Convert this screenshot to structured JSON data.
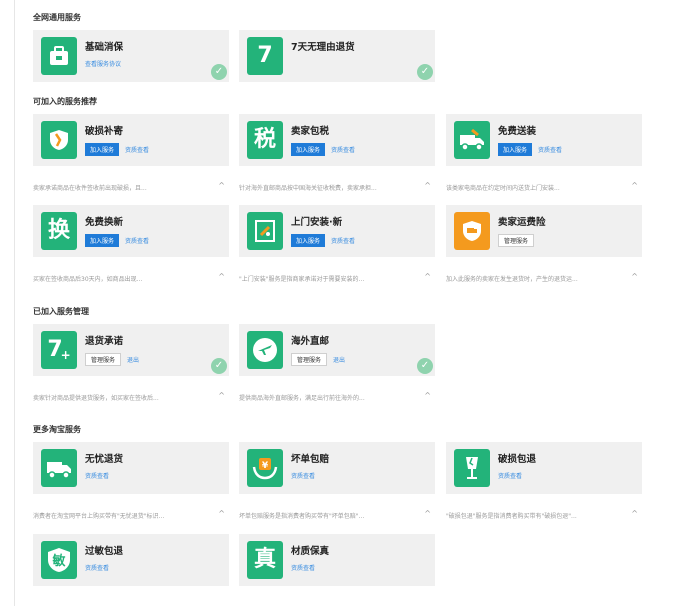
{
  "sections": {
    "network": "全网通用服务",
    "joinable": "可加入的服务推荐",
    "joined": "已加入服务管理",
    "more": "更多淘宝服务"
  },
  "buttons": {
    "join": "加入服务",
    "detail": "资质查看",
    "manage": "管理服务",
    "exit": "退出",
    "agreement": "查看服务协议"
  },
  "cards": {
    "basic": {
      "name": "基础消保",
      "glyph": ""
    },
    "seven_day": {
      "name": "7天无理由退货",
      "glyph": "7"
    },
    "damage": {
      "name": "破损补寄",
      "desc": "卖家承诺商品在收件签收前出现破损，且..."
    },
    "tax": {
      "name": "卖家包税",
      "glyph": "税",
      "desc": "针对海外直邮商品按中国海关征收税费，卖家承担..."
    },
    "install_free": {
      "name": "免费送装",
      "desc": "该类家电商品在约定时间内送货上门安装..."
    },
    "exchange": {
      "name": "免费换新",
      "glyph": "换",
      "desc": "买家在签收商品后30天内，如商品出现..."
    },
    "install": {
      "name": "上门安装·新",
      "desc": "\"上门安装\"服务是指商家承诺对于需要安装的..."
    },
    "freight": {
      "name": "卖家运费险",
      "desc": "加入此服务的卖家在发生退货时，产生的退货运..."
    },
    "return_promise": {
      "name": "退货承诺",
      "glyph": "7",
      "desc": "卖家针对商品提供退货服务，如买家在签收后..."
    },
    "overseas": {
      "name": "海外直邮",
      "desc": "提供商品海外直邮服务，满足出行前往海外的..."
    },
    "no_worry": {
      "name": "无忧退货",
      "desc": "消费者在淘宝网平台上购买带有\"无忧退货\"标识..."
    },
    "bad_order": {
      "name": "坏单包赔",
      "glyph": "¥",
      "desc": "坏单包赔服务是指消费者购买带有\"坏单包赔\"..."
    },
    "break_return": {
      "name": "破损包退",
      "desc": "\"破损包退\"服务是指消费者购买带有\"破损包退\"..."
    },
    "allergy": {
      "name": "过敏包退",
      "glyph": "敏"
    },
    "material": {
      "name": "材质保真",
      "glyph": "真"
    }
  },
  "collapse_glyph": "^",
  "check_glyph": "✓",
  "colors": {
    "green": "#23b37a",
    "orange": "#f49a1e",
    "blue": "#1f7bd8",
    "check": "#8fd3ae"
  }
}
